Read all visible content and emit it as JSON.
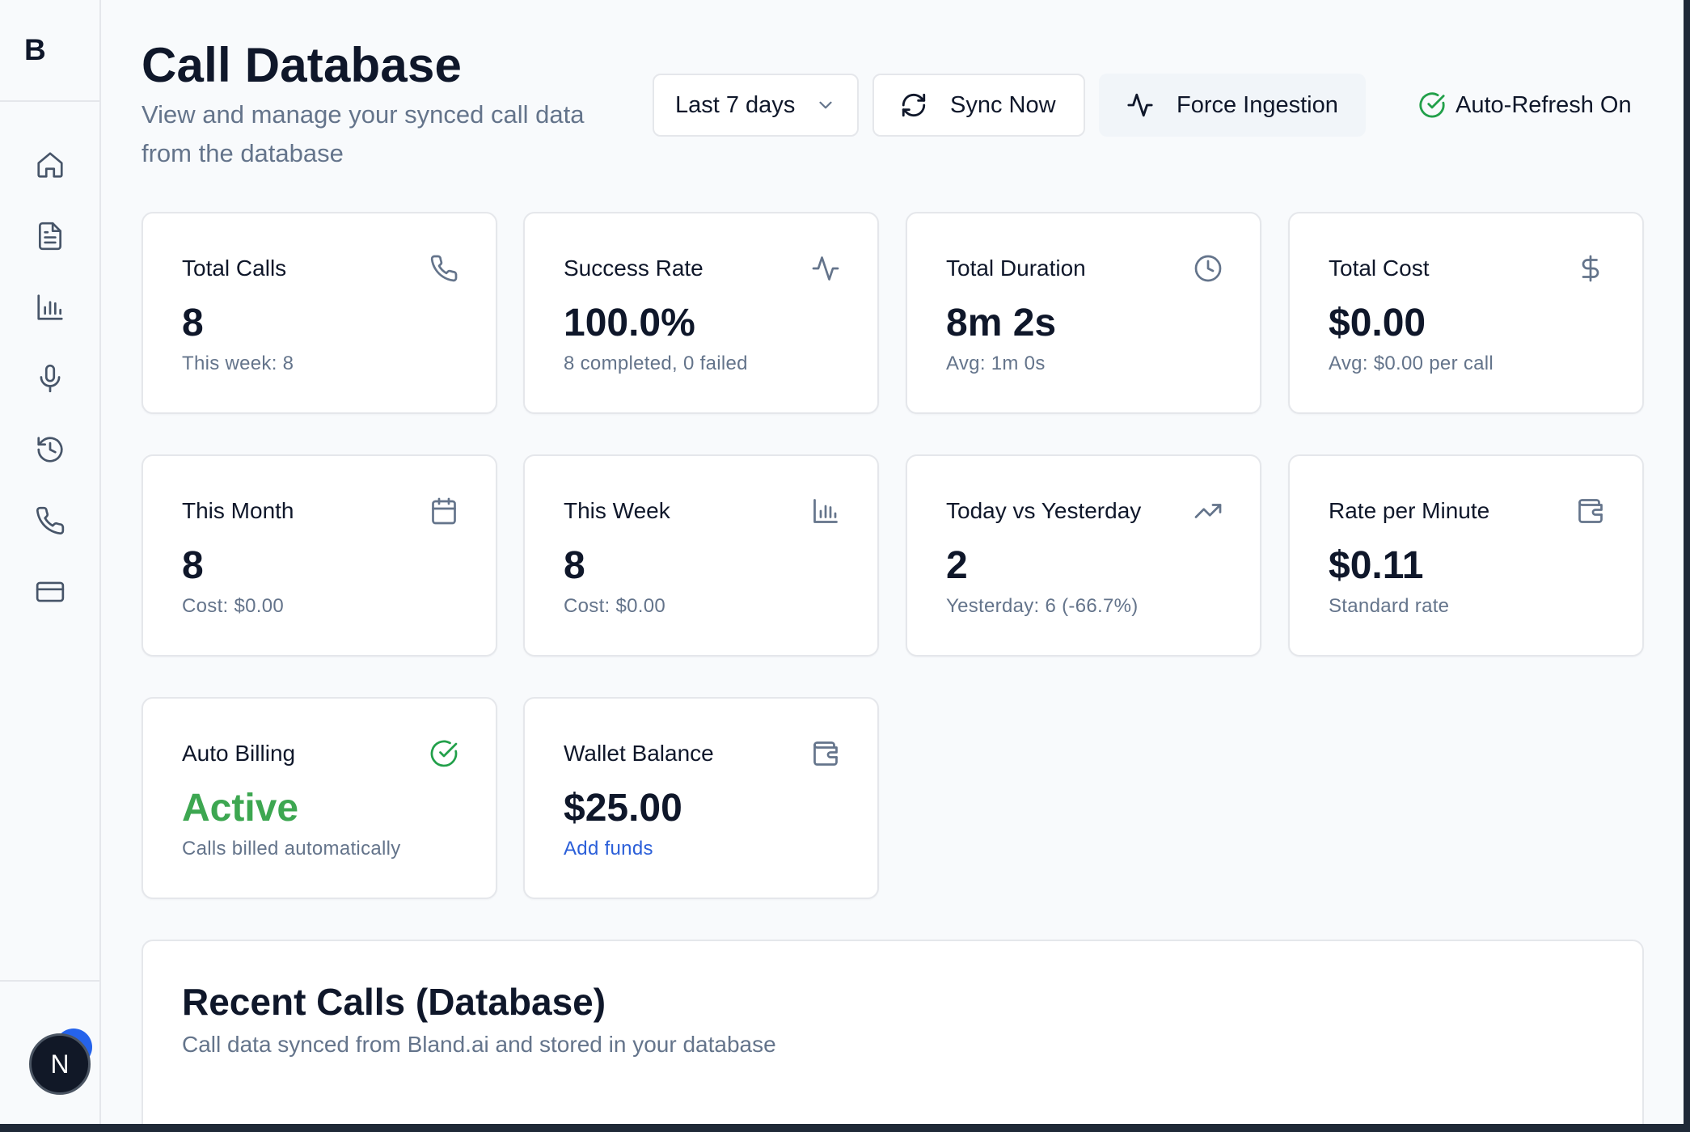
{
  "app": {
    "logo": "B"
  },
  "sidebar": {
    "items": [
      {
        "icon": "home-icon"
      },
      {
        "icon": "document-icon"
      },
      {
        "icon": "bar-chart-icon"
      },
      {
        "icon": "microphone-icon"
      },
      {
        "icon": "history-icon"
      },
      {
        "icon": "phone-icon"
      },
      {
        "icon": "credit-card-icon"
      }
    ],
    "avatar_initial": "N"
  },
  "header": {
    "title": "Call Database",
    "subtitle": "View and manage your synced call data from the database"
  },
  "toolbar": {
    "range_select": {
      "selected": "Last 7 days"
    },
    "sync_label": "Sync Now",
    "force_label": "Force Ingestion",
    "auto_refresh_label": "Auto-Refresh On"
  },
  "cards": [
    {
      "title": "Total Calls",
      "value": "8",
      "sub": "This week: 8",
      "icon": "phone-icon"
    },
    {
      "title": "Success Rate",
      "value": "100.0%",
      "sub": "8 completed, 0 failed",
      "icon": "activity-icon"
    },
    {
      "title": "Total Duration",
      "value": "8m 2s",
      "sub": "Avg: 1m 0s",
      "icon": "clock-icon"
    },
    {
      "title": "Total Cost",
      "value": "$0.00",
      "sub": "Avg: $0.00 per call",
      "icon": "dollar-icon"
    },
    {
      "title": "This Month",
      "value": "8",
      "sub": "Cost: $0.00",
      "icon": "calendar-icon"
    },
    {
      "title": "This Week",
      "value": "8",
      "sub": "Cost: $0.00",
      "icon": "bar-chart-icon"
    },
    {
      "title": "Today vs Yesterday",
      "value": "2",
      "sub": "Yesterday: 6 (-66.7%)",
      "icon": "trending-up-icon"
    },
    {
      "title": "Rate per Minute",
      "value": "$0.11",
      "sub": "Standard rate",
      "icon": "wallet-icon"
    },
    {
      "title": "Auto Billing",
      "value": "Active",
      "sub": "Calls billed automatically",
      "icon": "check-circle-icon"
    },
    {
      "title": "Wallet Balance",
      "value": "$25.00",
      "sub": "Add funds",
      "icon": "wallet-icon"
    }
  ],
  "colors": {
    "success": "#3da751",
    "link": "#2b5fd9",
    "muted": "#64748b"
  },
  "recent": {
    "title": "Recent Calls (Database)",
    "subtitle": "Call data synced from Bland.ai and stored in your database"
  }
}
